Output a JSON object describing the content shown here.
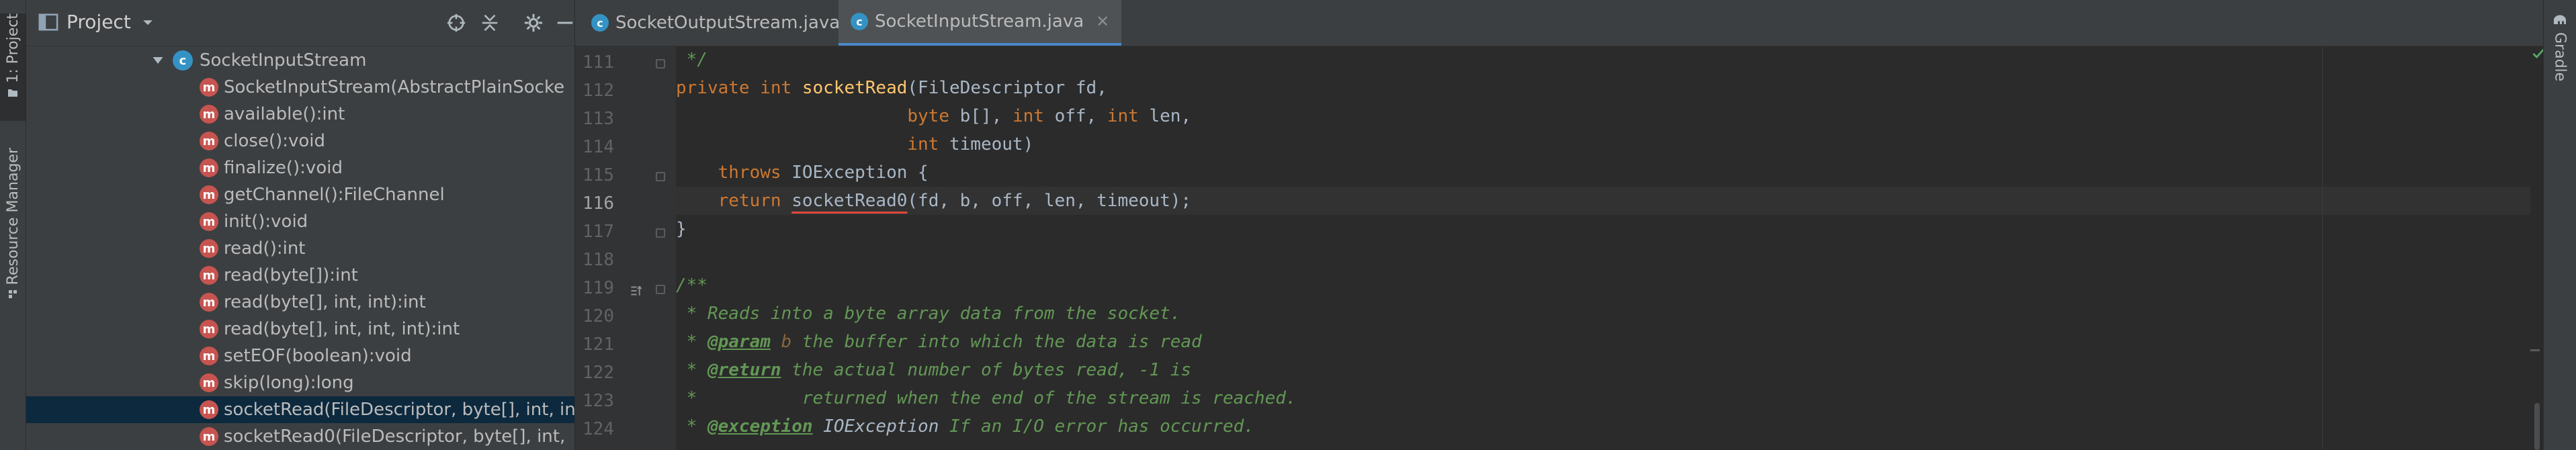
{
  "left_strip": {
    "project_tab": "1: Project",
    "resource_tab": "Resource Manager"
  },
  "project_panel": {
    "title": "Project",
    "tree": {
      "class_node": "SocketInputStream",
      "members": [
        "SocketInputStream(AbstractPlainSocke",
        "available():int",
        "close():void",
        "finalize():void",
        "getChannel():FileChannel",
        "init():void",
        "read():int",
        "read(byte[]):int",
        "read(byte[], int, int):int",
        "read(byte[], int, int, int):int",
        "setEOF(boolean):void",
        "skip(long):long",
        "socketRead(FileDescriptor, byte[], int, in",
        "socketRead0(FileDescriptor, byte[], int,"
      ],
      "selected_index": 12
    }
  },
  "editor": {
    "tabs": [
      {
        "label": "SocketOutputStream.java",
        "active": false
      },
      {
        "label": "SocketInputStream.java",
        "active": true
      }
    ],
    "line_numbers": [
      "111",
      "112",
      "113",
      "114",
      "115",
      "116",
      "117",
      "118",
      "119",
      "120",
      "121",
      "122",
      "123",
      "124"
    ],
    "current_line": "116",
    "code": {
      "l111": " */",
      "l112_kw1": "private ",
      "l112_kw2": "int ",
      "l112_fn": "socketRead",
      "l112_rest": "(FileDescriptor fd,",
      "l113_pad": "                      ",
      "l113_a": "byte ",
      "l113_b": "b[], ",
      "l113_c": "int ",
      "l113_d": "off, ",
      "l113_e": "int ",
      "l113_f": "len,",
      "l114_pad": "                      ",
      "l114_a": "int ",
      "l114_b": "timeout)",
      "l115_pad": "    ",
      "l115_kw": "throws ",
      "l115_rest": "IOException {",
      "l116_pad": "    ",
      "l116_kw": "return ",
      "l116_call": "socketRead0",
      "l116_rest": "(fd, b, off, len, timeout);",
      "l117": "}",
      "l118": "",
      "l119": "/**",
      "l120": " * Reads into a byte array data from the socket.",
      "l121_a": " * ",
      "l121_tag": "@param",
      "l121_v": " b",
      "l121_rest": " the buffer into which the data is read",
      "l122_a": " * ",
      "l122_tag": "@return",
      "l122_rest": " the actual number of bytes read, -1 is",
      "l123": " *          returned when the end of the stream is reached.",
      "l124_a": " * ",
      "l124_tag": "@exception",
      "l124_ty": " IOException",
      "l124_rest": " If an I/O error has occurred."
    }
  },
  "right_strip": {
    "gradle_tab": "Gradle"
  },
  "colors": {
    "background": "#2b2b2b",
    "panel": "#3c3f41",
    "keyword": "#cc7832",
    "function": "#ffc66d",
    "doc_comment": "#629755",
    "selection": "#0d293e",
    "error_underline": "#e04a3a",
    "ok_check": "#59a869"
  }
}
